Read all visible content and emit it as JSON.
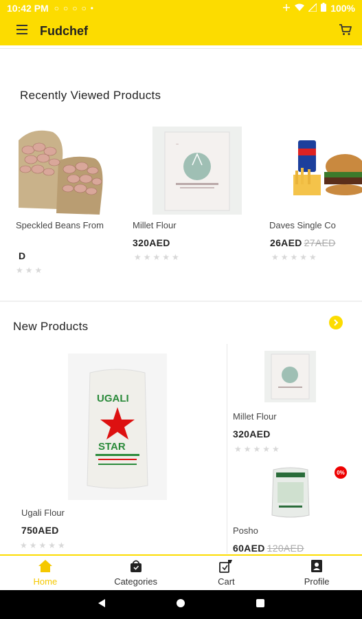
{
  "status_bar": {
    "time": "10:42 PM",
    "notifications": "○○○○•",
    "battery": "100%"
  },
  "app_bar": {
    "title": "Fudchef"
  },
  "recent": {
    "title": "Recently Viewed Products",
    "items": [
      {
        "name": "Speckled Beans From",
        "price": "D",
        "old_price": ""
      },
      {
        "name": "Millet Flour",
        "price": "320AED",
        "old_price": ""
      },
      {
        "name": "Daves Single Co",
        "price": "26AED",
        "old_price": "27AED"
      }
    ]
  },
  "new_products": {
    "title": "New Products",
    "items": [
      {
        "name": "Ugali Flour",
        "price": "750AED",
        "old_price": ""
      },
      {
        "name": "Millet Flour",
        "price": "320AED",
        "old_price": ""
      },
      {
        "name": "Posho",
        "price": "60AED",
        "old_price": "120AED",
        "badge": "0%"
      }
    ]
  },
  "bottom_nav": {
    "items": [
      {
        "label": "Home",
        "active": true
      },
      {
        "label": "Categories",
        "active": false
      },
      {
        "label": "Cart",
        "active": false
      },
      {
        "label": "Profile",
        "active": false
      }
    ]
  },
  "colors": {
    "accent": "#fcdc00",
    "active_nav": "#f5c800",
    "badge": "#e00000"
  },
  "icons": [
    "menu-icon",
    "cart-icon",
    "chevron-right-icon",
    "home-icon",
    "categories-bag-icon",
    "cart-nav-icon",
    "profile-icon",
    "back-icon",
    "home-circle-icon",
    "recents-icon",
    "wifi-icon",
    "signal-icon",
    "battery-icon"
  ]
}
